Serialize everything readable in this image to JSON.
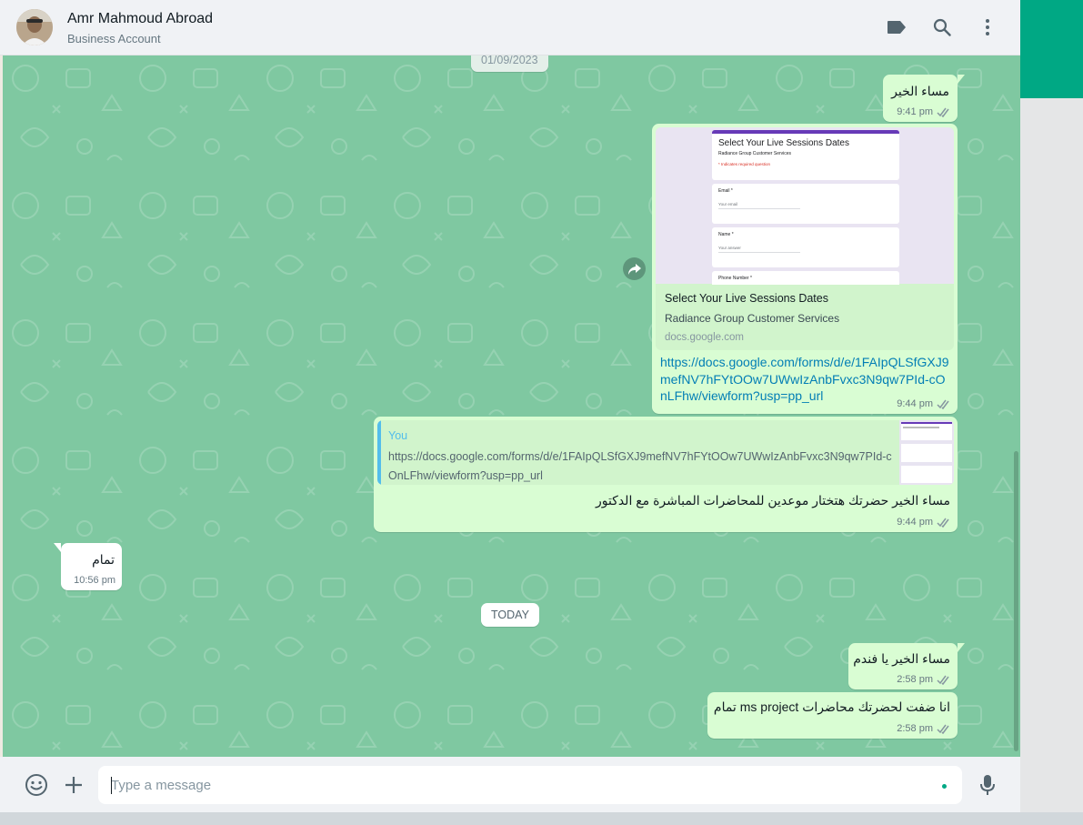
{
  "header": {
    "contact_name": "Amr Mahmoud Abroad",
    "contact_subtitle": "Business Account",
    "icons": [
      "label-icon",
      "search-icon",
      "menu-icon"
    ]
  },
  "chat": {
    "top_date": "01/09/2023",
    "today_label": "TODAY",
    "messages": [
      {
        "direction": "outgoing",
        "text": "مساء الخير",
        "time": "9:41 pm",
        "status": "read"
      },
      {
        "direction": "outgoing",
        "type": "link",
        "preview": {
          "title": "Select Your Live Sessions Dates",
          "description": "Radiance Group Customer Services",
          "domain": "docs.google.com",
          "form_title": "Select Your Live Sessions Dates",
          "form_subtitle": "Radiance Group Customer Services",
          "form_required": "* Indicates required question",
          "field_email": "Email *",
          "field_email_hint": "Your email",
          "field_name": "Name *",
          "field_name_hint": "Your answer",
          "field_phone": "Phone Number *"
        },
        "url": "https://docs.google.com/forms/d/e/1FAIpQLSfGXJ9mefNV7hFYtOOw7UWwIzAnbFvxc3N9qw7PId-cOnLFhw/viewform?usp=pp_url",
        "time": "9:44 pm",
        "status": "read"
      },
      {
        "direction": "outgoing",
        "type": "reply",
        "quote_author": "You",
        "quote_text": "https://docs.google.com/forms/d/e/1FAIpQLSfGXJ9mefNV7hFYtOOw7UWwIzAnbFvxc3N9qw7PId-cOnLFhw/viewform?usp=pp_url",
        "text": "مساء الخير حضرتك هتختار موعدين للمحاضرات المباشرة مع الدكتور",
        "time": "9:44 pm",
        "status": "read"
      },
      {
        "direction": "incoming",
        "text": "تمام",
        "time": "10:56 pm"
      },
      {
        "direction": "outgoing",
        "text": "مساء الخير يا فندم",
        "time": "2:58 pm",
        "status": "read"
      },
      {
        "direction": "outgoing",
        "text": "انا ضفت لحضرتك محاضرات ms project تمام",
        "time": "2:58 pm",
        "status": "read"
      }
    ]
  },
  "composer": {
    "placeholder": "Type a message",
    "icons": [
      "emoji-icon",
      "attach-plus-icon",
      "microphone-icon"
    ]
  },
  "colors": {
    "accent": "#00a884",
    "chat_bg": "#7fc8a1",
    "outgoing_bubble": "#d9fdd3",
    "incoming_bubble": "#ffffff",
    "link": "#027eb5",
    "read_ticks": "#8696a0"
  }
}
